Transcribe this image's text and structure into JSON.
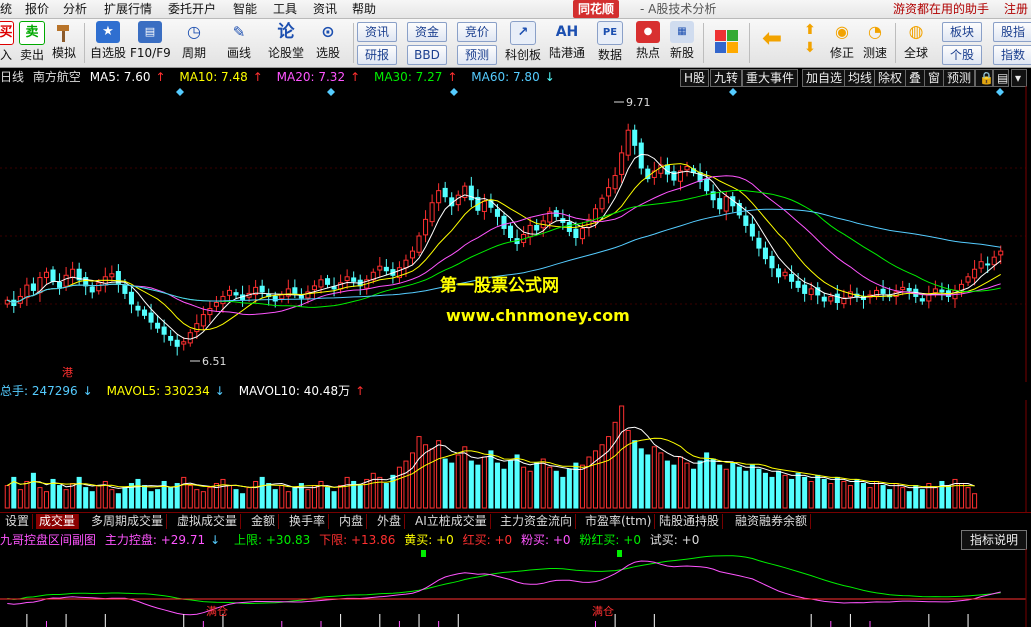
{
  "menu": {
    "items": [
      "统",
      "报价",
      "分析",
      "扩展行情",
      "委托开户",
      "智能",
      "工具",
      "资讯",
      "帮助"
    ],
    "brand": "同花顺",
    "title": "- A股技术分析",
    "helper": "游资都在用的助手",
    "register": "注册"
  },
  "toolbar": {
    "buttons": [
      "入",
      "卖出",
      "模拟",
      "自选股",
      "F10/F9",
      "周期",
      "画线",
      "论股堂",
      "选股",
      "科创板",
      "陆港通",
      "数据",
      "热点",
      "新股",
      "全球",
      "修正",
      "测速"
    ],
    "small_buttons": [
      "资讯",
      "研报",
      "资金",
      "BBD",
      "竞价",
      "预测",
      "板块",
      "个股",
      "股指",
      "指数"
    ],
    "icon_text": [
      "买",
      "卖",
      "AH",
      "PE",
      "论"
    ]
  },
  "ma_info": {
    "period": "日线",
    "stock": "南方航空",
    "ma5": "MA5: 7.60",
    "ma10": "MA10: 7.48",
    "ma20": "MA20: 7.32",
    "ma30": "MA30: 7.27",
    "ma60": "MA60: 7.80"
  },
  "right_tabs": [
    "H股",
    "九转",
    "重大事件",
    "加自选",
    "均线",
    "除权",
    "叠",
    "窗",
    "预测"
  ],
  "chart_data": {
    "type": "candlestick",
    "high_label": "9.71",
    "low_label": "6.51",
    "marker": "港",
    "ylim": [
      6.3,
      9.9
    ],
    "colors": {
      "up": "#ff3030",
      "down": "#54ffff",
      "ma5": "#ffffff",
      "ma10": "#ffff00",
      "ma20": "#ff55ff",
      "ma30": "#00ee00",
      "ma60": "#55ccff"
    },
    "closes": [
      7.25,
      7.18,
      7.3,
      7.45,
      7.38,
      7.55,
      7.62,
      7.5,
      7.42,
      7.58,
      7.66,
      7.52,
      7.44,
      7.36,
      7.48,
      7.56,
      7.6,
      7.46,
      7.34,
      7.2,
      7.12,
      7.05,
      6.96,
      6.88,
      6.8,
      6.72,
      6.64,
      6.7,
      6.82,
      6.94,
      7.06,
      7.14,
      7.22,
      7.3,
      7.38,
      7.32,
      7.26,
      7.34,
      7.42,
      7.36,
      7.3,
      7.24,
      7.32,
      7.4,
      7.34,
      7.28,
      7.36,
      7.44,
      7.52,
      7.46,
      7.4,
      7.48,
      7.56,
      7.5,
      7.44,
      7.52,
      7.62,
      7.7,
      7.64,
      7.58,
      7.68,
      7.78,
      7.9,
      8.1,
      8.32,
      8.54,
      8.7,
      8.62,
      8.5,
      8.64,
      8.76,
      8.58,
      8.44,
      8.56,
      8.48,
      8.36,
      8.2,
      8.08,
      8.0,
      8.12,
      8.24,
      8.18,
      8.3,
      8.42,
      8.36,
      8.28,
      8.16,
      8.08,
      8.2,
      8.32,
      8.46,
      8.6,
      8.74,
      8.9,
      9.2,
      9.5,
      9.3,
      9.0,
      8.86,
      8.96,
      9.04,
      8.92,
      8.84,
      8.96,
      9.02,
      8.94,
      8.82,
      8.7,
      8.58,
      8.46,
      8.62,
      8.5,
      8.38,
      8.24,
      8.1,
      7.94,
      7.8,
      7.68,
      7.56,
      7.62,
      7.5,
      7.42,
      7.34,
      7.4,
      7.32,
      7.24,
      7.3,
      7.22,
      7.28,
      7.36,
      7.3,
      7.26,
      7.32,
      7.38,
      7.34,
      7.3,
      7.36,
      7.42,
      7.38,
      7.3,
      7.24,
      7.32,
      7.4,
      7.36,
      7.3,
      7.38,
      7.46,
      7.56,
      7.66,
      7.76,
      7.72,
      7.82,
      7.9
    ]
  },
  "volume_info": {
    "total": "总手: 247296",
    "mavol5": "MAVOL5: 330234",
    "mavol10": "MAVOL10: 40.48万"
  },
  "volume_data": {
    "values": [
      22,
      30,
      18,
      26,
      34,
      20,
      16,
      28,
      22,
      18,
      24,
      30,
      20,
      16,
      22,
      26,
      18,
      14,
      20,
      24,
      28,
      22,
      16,
      18,
      26,
      20,
      24,
      30,
      22,
      18,
      16,
      20,
      24,
      28,
      22,
      18,
      14,
      20,
      26,
      30,
      24,
      18,
      22,
      16,
      20,
      24,
      18,
      22,
      26,
      20,
      16,
      22,
      30,
      26,
      22,
      28,
      34,
      30,
      24,
      32,
      40,
      46,
      54,
      70,
      62,
      58,
      66,
      48,
      44,
      52,
      60,
      46,
      42,
      50,
      56,
      44,
      38,
      46,
      52,
      40,
      36,
      44,
      48,
      40,
      36,
      30,
      38,
      44,
      42,
      50,
      56,
      62,
      70,
      84,
      100,
      76,
      66,
      58,
      52,
      60,
      54,
      46,
      42,
      50,
      44,
      38,
      46,
      54,
      48,
      42,
      38,
      44,
      40,
      36,
      42,
      38,
      34,
      30,
      36,
      32,
      28,
      34,
      30,
      26,
      32,
      28,
      24,
      30,
      26,
      22,
      28,
      24,
      20,
      26,
      22,
      18,
      24,
      20,
      16,
      22,
      18,
      24,
      20,
      26,
      22,
      28,
      24,
      20,
      14
    ]
  },
  "indicator_tabs": [
    "设置",
    "成交量",
    "多周期成交量",
    "虚拟成交量",
    "金额",
    "换手率",
    "内盘",
    "外盘",
    "AI立桩成交量",
    "主力资金流向",
    "市盈率(ttm)",
    "陆股通持股",
    "融资融券余额"
  ],
  "indicator_info": {
    "name": "九哥控盘区间副图",
    "control": "主力控盘: +29.71",
    "upper": "上限: +30.83",
    "lower": "下限: +13.86",
    "yellow_buy": "黄买: +0",
    "red_buy": "红买: +0",
    "pink_buy": "粉买: +0",
    "pink_red_buy": "粉红买: +0",
    "try_buy": "试买: +0"
  },
  "indicator_labels": {
    "full_position": "满仓"
  },
  "explain_button": "指标说明",
  "watermark": {
    "line1": "第一股票公式网",
    "line2": "www.chnmoney.com"
  }
}
